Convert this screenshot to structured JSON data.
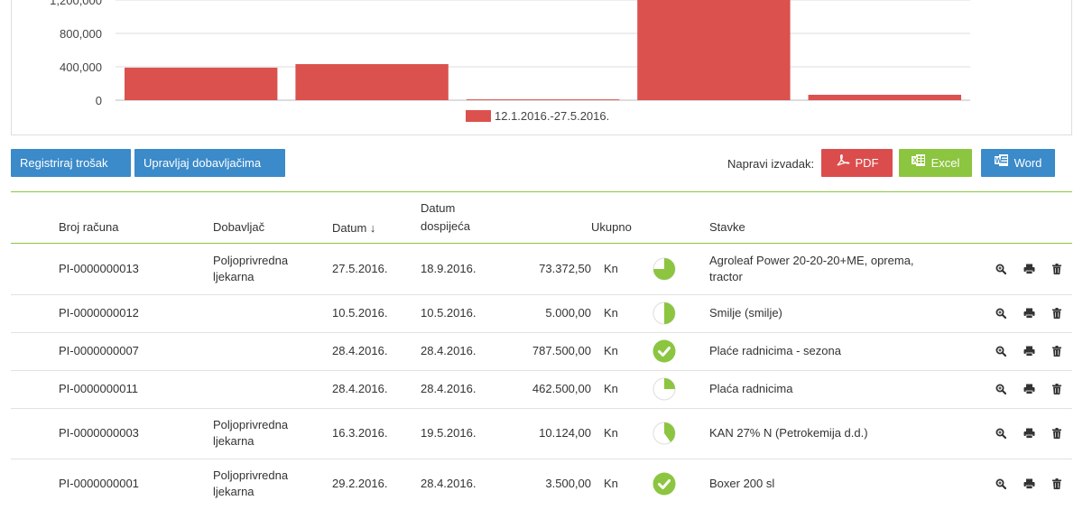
{
  "chart_data": {
    "type": "bar",
    "ylim": [
      0,
      1200000
    ],
    "yticks": [
      "0",
      "400,000",
      "800,000",
      "1,200,000"
    ],
    "ytick_values": [
      0,
      400000,
      800000,
      1200000
    ],
    "series": [
      {
        "name": "12.1.2016.-27.5.2016.",
        "color": "#db514e",
        "values": [
          390000,
          432000,
          10000,
          1250000,
          65000
        ]
      }
    ],
    "legend_position": "bottom",
    "grid": true
  },
  "toolbar": {
    "register_label": "Registriraj trošak",
    "manage_label": "Upravljaj dobavljačima",
    "export_label": "Napravi izvadak:",
    "pdf_label": "PDF",
    "excel_label": "Excel",
    "word_label": "Word"
  },
  "table": {
    "headers": {
      "invoice": "Broj računa",
      "supplier": "Dobavljač",
      "date": "Datum ↓",
      "due_line1": "Datum",
      "due_line2": "dospijeća",
      "total": "Ukupno",
      "items": "Stavke"
    },
    "rows": [
      {
        "invoice": "PI-0000000013",
        "supplier_l1": "Poljoprivredna",
        "supplier_l2": "ljekarna",
        "date": "27.5.2016.",
        "due": "18.9.2016.",
        "amount": "73.372,50",
        "currency": "Kn",
        "paid": 0.75,
        "items_l1": "Agroleaf Power 20-20-20+ME, oprema,",
        "items_l2": "tractor"
      },
      {
        "invoice": "PI-0000000012",
        "supplier_l1": "",
        "supplier_l2": "",
        "date": "10.5.2016.",
        "due": "10.5.2016.",
        "amount": "5.000,00",
        "currency": "Kn",
        "paid": 0.5,
        "items_l1": "Smilje (smilje)",
        "items_l2": ""
      },
      {
        "invoice": "PI-0000000007",
        "supplier_l1": "",
        "supplier_l2": "",
        "date": "28.4.2016.",
        "due": "28.4.2016.",
        "amount": "787.500,00",
        "currency": "Kn",
        "paid": 1.0,
        "items_l1": "Plaće radnicima - sezona",
        "items_l2": ""
      },
      {
        "invoice": "PI-0000000011",
        "supplier_l1": "",
        "supplier_l2": "",
        "date": "28.4.2016.",
        "due": "28.4.2016.",
        "amount": "462.500,00",
        "currency": "Kn",
        "paid": 0.25,
        "items_l1": "Plaća radnicima",
        "items_l2": ""
      },
      {
        "invoice": "PI-0000000003",
        "supplier_l1": "Poljoprivredna",
        "supplier_l2": "ljekarna",
        "date": "16.3.2016.",
        "due": "19.5.2016.",
        "amount": "10.124,00",
        "currency": "Kn",
        "paid": 0.4,
        "items_l1": "KAN 27% N (Petrokemija d.d.)",
        "items_l2": ""
      },
      {
        "invoice": "PI-0000000001",
        "supplier_l1": "Poljoprivredna",
        "supplier_l2": "ljekarna",
        "date": "29.2.2016.",
        "due": "28.4.2016.",
        "amount": "3.500,00",
        "currency": "Kn",
        "paid": 1.0,
        "items_l1": "Boxer 200 sl",
        "items_l2": ""
      }
    ]
  },
  "colors": {
    "accent_green": "#8cc540",
    "button_blue": "#3b8ac9",
    "button_red": "#db4d4d",
    "bar_red": "#db514e"
  },
  "icons": {
    "view": "magnifier-icon",
    "print": "printer-icon",
    "delete": "trash-icon"
  }
}
